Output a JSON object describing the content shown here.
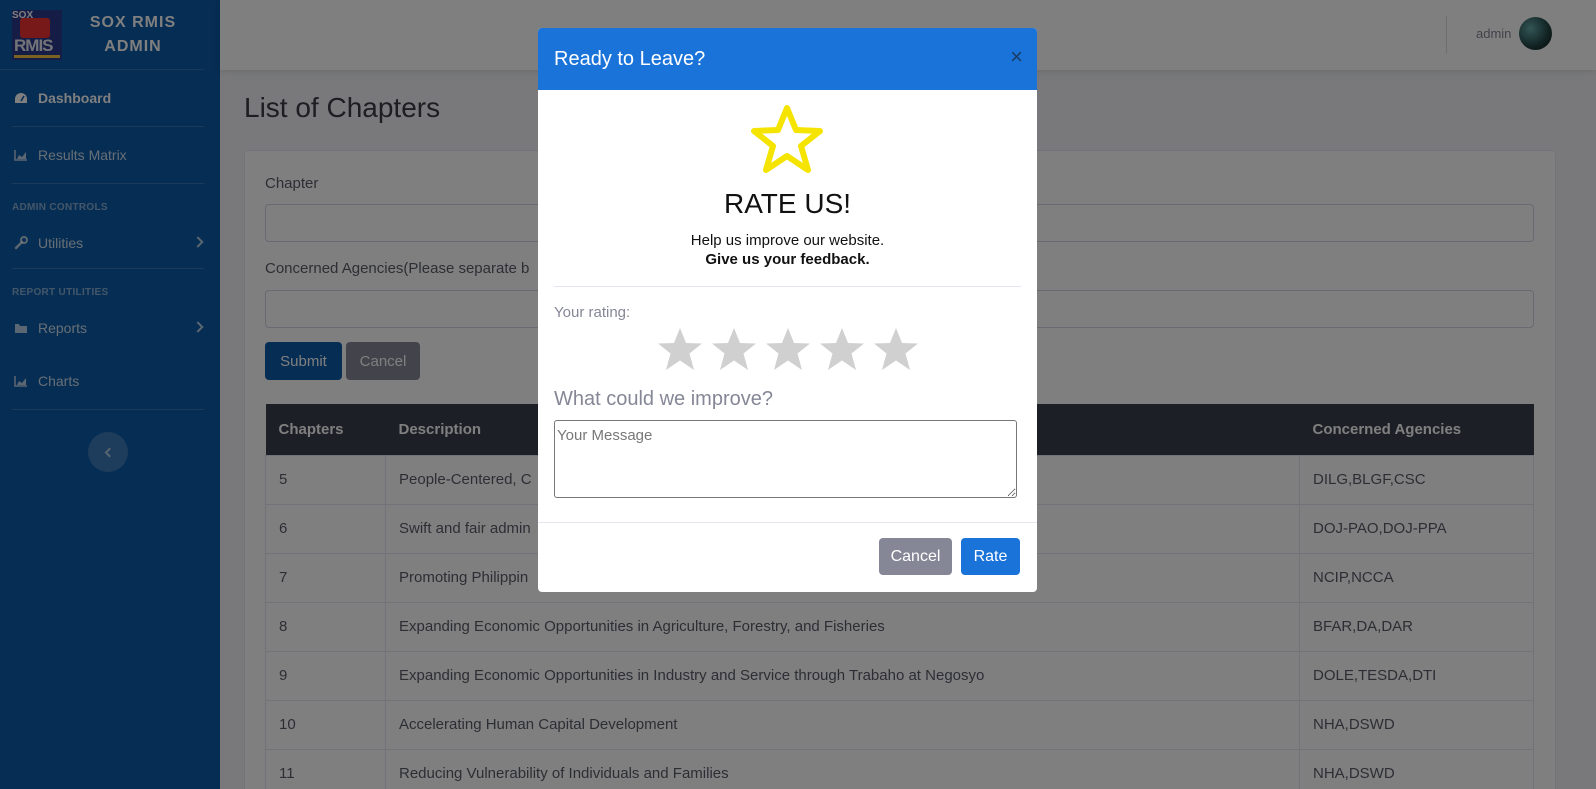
{
  "sidebar": {
    "brand_line1": "SOX RMIS",
    "brand_line2": "ADMIN",
    "logo_text_top": "SOX",
    "logo_text_main": "RMIS",
    "items": [
      {
        "label": "Dashboard",
        "icon": "tachometer-icon"
      },
      {
        "label": "Results Matrix",
        "icon": "chart-area-icon"
      },
      {
        "label": "Utilities",
        "icon": "wrench-icon"
      },
      {
        "label": "Reports",
        "icon": "folder-icon"
      },
      {
        "label": "Charts",
        "icon": "chart-area-icon"
      }
    ],
    "headings": [
      "ADMIN CONTROLS",
      "REPORT UTILITIES"
    ]
  },
  "topbar": {
    "user": "admin"
  },
  "page": {
    "title": "List of Chapters",
    "chapter_label": "Chapter",
    "agencies_label": "Concerned Agencies(Please separate b",
    "submit_label": "Submit",
    "cancel_label": "Cancel"
  },
  "table": {
    "headers": [
      "Chapters",
      "Description",
      "Concerned Agencies"
    ],
    "rows": [
      {
        "chapter": "5",
        "description": "People-Centered, C",
        "agencies": "DILG,BLGF,CSC"
      },
      {
        "chapter": "6",
        "description": "Swift and fair admin",
        "agencies": "DOJ-PAO,DOJ-PPA"
      },
      {
        "chapter": "7",
        "description": "Promoting Philippin",
        "agencies": "NCIP,NCCA"
      },
      {
        "chapter": "8",
        "description": "Expanding Economic Opportunities in Agriculture, Forestry, and Fisheries",
        "agencies": "BFAR,DA,DAR"
      },
      {
        "chapter": "9",
        "description": "Expanding Economic Opportunities in Industry and Service through Trabaho at Negosyo",
        "agencies": "DOLE,TESDA,DTI"
      },
      {
        "chapter": "10",
        "description": "Accelerating Human Capital Development",
        "agencies": "NHA,DSWD"
      },
      {
        "chapter": "11",
        "description": "Reducing Vulnerability of Individuals and Families",
        "agencies": "NHA,DSWD"
      }
    ]
  },
  "modal": {
    "title": "Ready to Leave?",
    "close": "×",
    "rate_title": "RATE US!",
    "help_text": "Help us improve our website.",
    "feedback_text": "Give us your feedback.",
    "rating_label": "Your rating:",
    "rating_value": 0,
    "rating_max": 5,
    "improve_label": "What could we improve?",
    "message_placeholder": "Your Message",
    "cancel_label": "Cancel",
    "rate_label": "Rate"
  },
  "colors": {
    "sidebar": "#0d5aa7",
    "modal_header": "#1a73d9",
    "star_outline": "#f5e400",
    "star_empty": "#d0d0d0",
    "table_header": "#3b3f4d"
  }
}
